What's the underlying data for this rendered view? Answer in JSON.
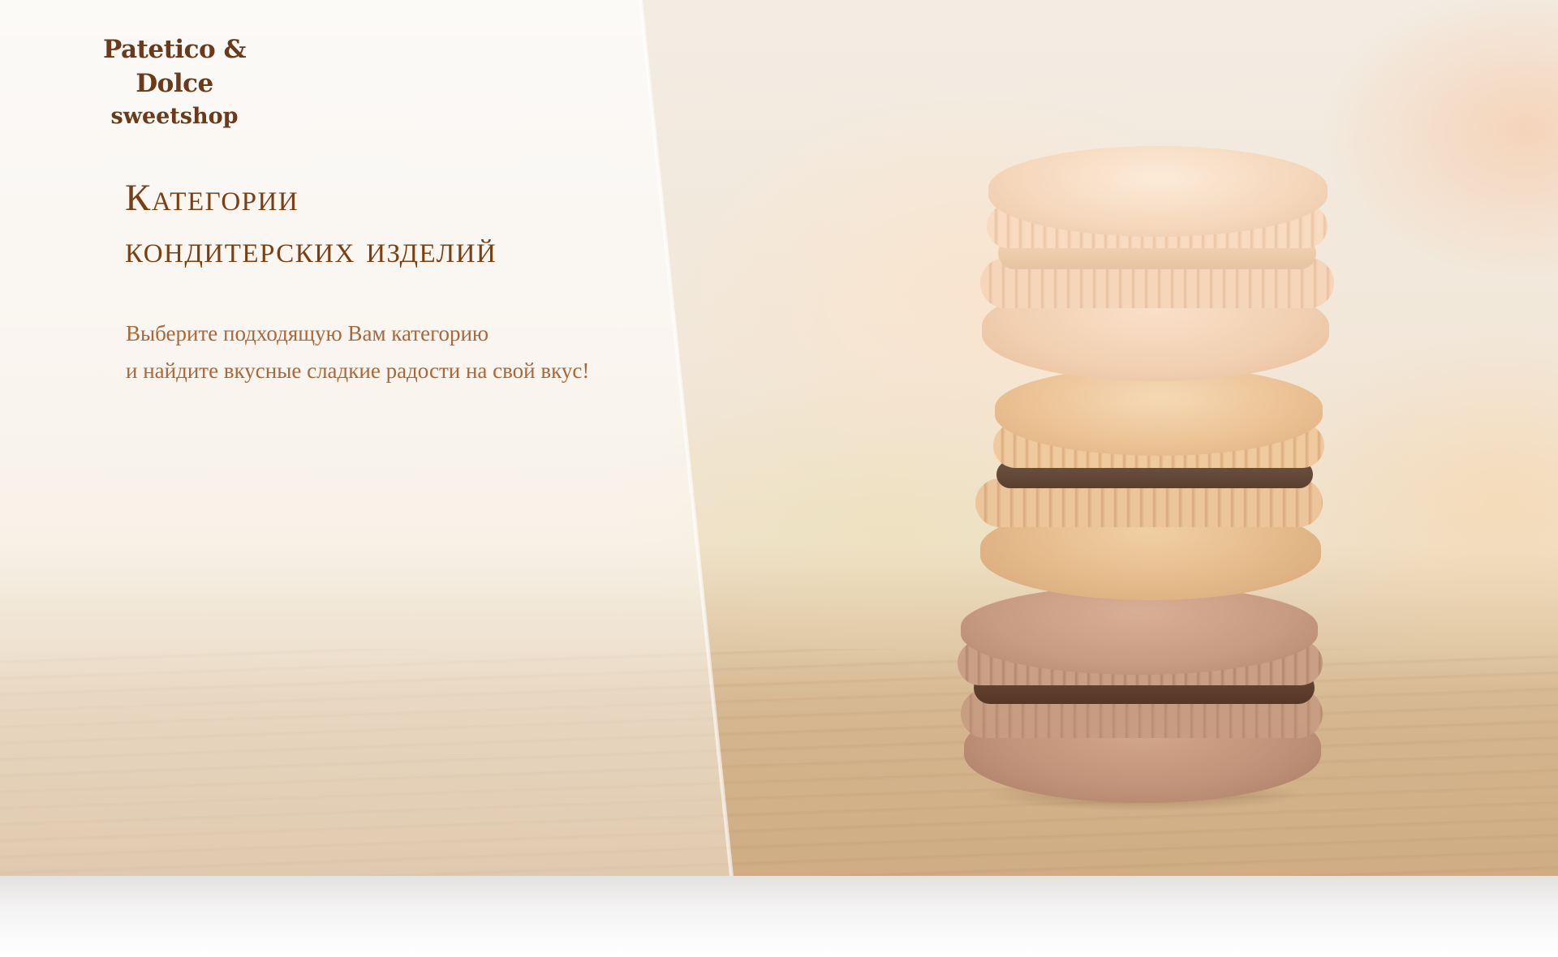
{
  "brand": {
    "name": "Patetico & Dolce",
    "tagline": "sweetshop"
  },
  "hero": {
    "heading_line1": "Категории",
    "heading_line2": "кондитерских изделий",
    "subtitle_line1": "Выберите подходящую Вам категорию",
    "subtitle_line2": "и найдите вкусные сладкие радости на свой вкус!",
    "image": "stack-of-macarons"
  },
  "colors": {
    "heading": "#7a3f12",
    "subtitle": "#a9683a",
    "logo": "#6b3a1a",
    "macaron_top": "#f3cfb0",
    "macaron_middle": "#e9bc8c",
    "macaron_bottom": "#c89a80",
    "filling_dark": "#5e3f2c"
  }
}
